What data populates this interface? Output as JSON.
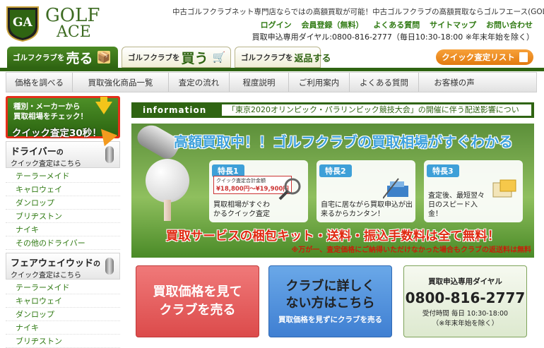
{
  "logo": {
    "monogram": "GA",
    "word_line1": "GOLF",
    "word_line2": "ACE"
  },
  "header": {
    "tagline": "中古ゴルフクラブネット専門店ならではの高額買取が可能！中古ゴルフクラブの高額買取ならゴルフエース(GOLF ACE)",
    "links": [
      "ログイン",
      "会員登録（無料）",
      "よくある質問",
      "サイトマップ",
      "お問い合わせ"
    ],
    "phone_line": "買取申込専用ダイヤル:0800-816-2777（毎日10:30-18:00 ※年末年始を除く）"
  },
  "tabs": {
    "sell": {
      "pre": "ゴルフクラブを",
      "big": "売る",
      "icon": "📦"
    },
    "buy": {
      "pre": "ゴルフクラブを",
      "big": "買う",
      "icon": "🛒"
    },
    "return": {
      "pre": "ゴルフクラブを",
      "big": "返品する"
    }
  },
  "quick_list_label": "クイック査定リスト",
  "nav": [
    "価格を調べる",
    "買取強化商品一覧",
    "査定の流れ",
    "程度説明",
    "ご利用案内",
    "よくある質問",
    "お客様の声"
  ],
  "sidebar": {
    "banner_line1": "種別・メーカーから",
    "banner_line2": "買取相場をチェック！",
    "banner_line3": "クイック査定30秒！",
    "driver": {
      "title": "ドライバー",
      "title_suffix": "の",
      "sub": "クイック査定はこちら",
      "items": [
        "テーラーメイド",
        "キャロウェイ",
        "ダンロップ",
        "ブリヂストン",
        "ナイキ",
        "その他のドライバー"
      ]
    },
    "fairway": {
      "title": "フェアウェイウッド",
      "title_suffix": "の",
      "sub": "クイック査定はこちら",
      "items": [
        "テーラーメイド",
        "キャロウェイ",
        "ダンロップ",
        "ナイキ",
        "ブリヂストン"
      ]
    }
  },
  "info": {
    "label": "information",
    "news": "「東京2020オリンピック・パラリンピック競技大会」の開催に伴う配送影響につい"
  },
  "hero": {
    "title": "高額買取中！！ゴルフクラブの買取相場がすぐわかる",
    "features": [
      {
        "badge": "特長1",
        "desc": "買取相場がすぐわかるクイック査定",
        "price_label": "クイック査定合計金額",
        "price": "¥18,800円〜¥19,900円"
      },
      {
        "badge": "特長2",
        "desc": "自宅に居ながら買取申込が出来るからカンタン！"
      },
      {
        "badge": "特長3",
        "desc": "査定後、最短翌々日のスピード入金！"
      }
    ],
    "bottom": "買取サービスの梱包キット・送料・振込手数料は全て無料！",
    "note": "※万が一、査定価格にご納得いただけなかった場合もクラブの返送料は無料"
  },
  "cta": {
    "sell_line1": "買取価格を見て",
    "sell_line2": "クラブを売る",
    "help_line1": "クラブに詳しく",
    "help_line2": "ない方はこちら",
    "help_sub": "買取価格を見ずにクラブを売る",
    "phone_label": "買取申込専用ダイヤル",
    "phone_number": "0800-816-2777",
    "phone_hours": "受付時間 毎日 10:30-18:00",
    "phone_note": "（※年末年始を除く）"
  },
  "colors": {
    "brand_green": "#2f6412",
    "accent_orange": "#f39a1f",
    "alert_red": "#e02a12",
    "feature_blue": "#3ea0d8"
  }
}
